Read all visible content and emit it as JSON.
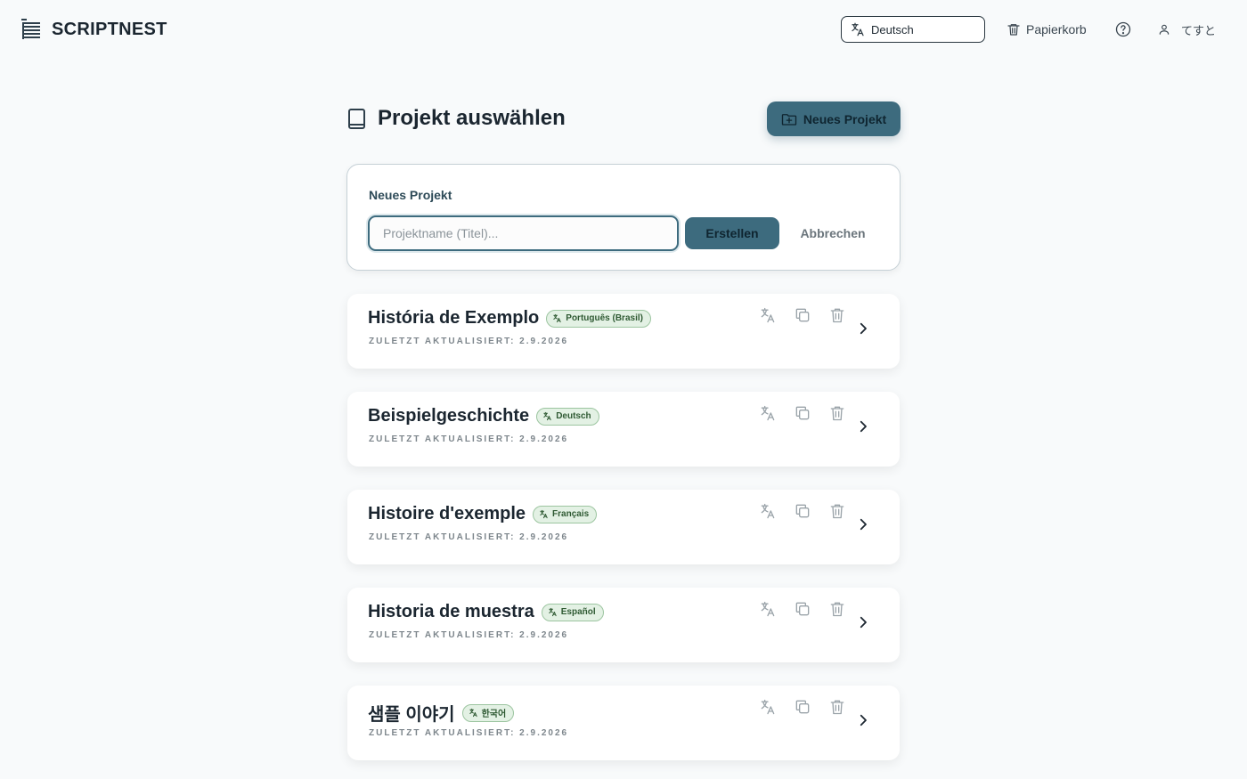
{
  "header": {
    "app_name": "SCRIPTNEST",
    "language_select": {
      "value": "Deutsch"
    },
    "trash_label": "Papierkorb",
    "user_label": "てすと"
  },
  "page": {
    "title": "Projekt auswählen",
    "new_project_button": "Neues Projekt"
  },
  "new_project_form": {
    "label": "Neues Projekt",
    "name_input": {
      "value": "",
      "placeholder": "Projektname (Titel)..."
    },
    "create_button": "Erstellen",
    "cancel_button": "Abbrechen"
  },
  "projects": [
    {
      "title": "História de Exemplo",
      "language": "Português (Brasil)",
      "updated": "ZULETZT AKTUALISIERT: 2.9.2026"
    },
    {
      "title": "Beispielgeschichte",
      "language": "Deutsch",
      "updated": "ZULETZT AKTUALISIERT: 2.9.2026"
    },
    {
      "title": "Histoire d'exemple",
      "language": "Français",
      "updated": "ZULETZT AKTUALISIERT: 2.9.2026"
    },
    {
      "title": "Historia de muestra",
      "language": "Español",
      "updated": "ZULETZT AKTUALISIERT: 2.9.2026"
    },
    {
      "title": "샘플 이야기",
      "language": "한국어",
      "updated": "ZULETZT AKTUALISIERT: 2.9.2026"
    }
  ],
  "icons": {
    "logo": "list-logo-icon",
    "language": "translate-icon",
    "trash": "trash-icon",
    "help": "help-circle-icon",
    "user": "user-icon",
    "title": "book-icon",
    "new_project": "folder-plus-icon",
    "project_actions": [
      "translate-icon",
      "copy-icon",
      "trash-icon",
      "chevron-right-icon"
    ]
  },
  "colors": {
    "accent": "#3d6b7e",
    "badge_bg": "#e3f1e4",
    "badge_text": "#2f5a33",
    "background": "#f8fafb"
  }
}
